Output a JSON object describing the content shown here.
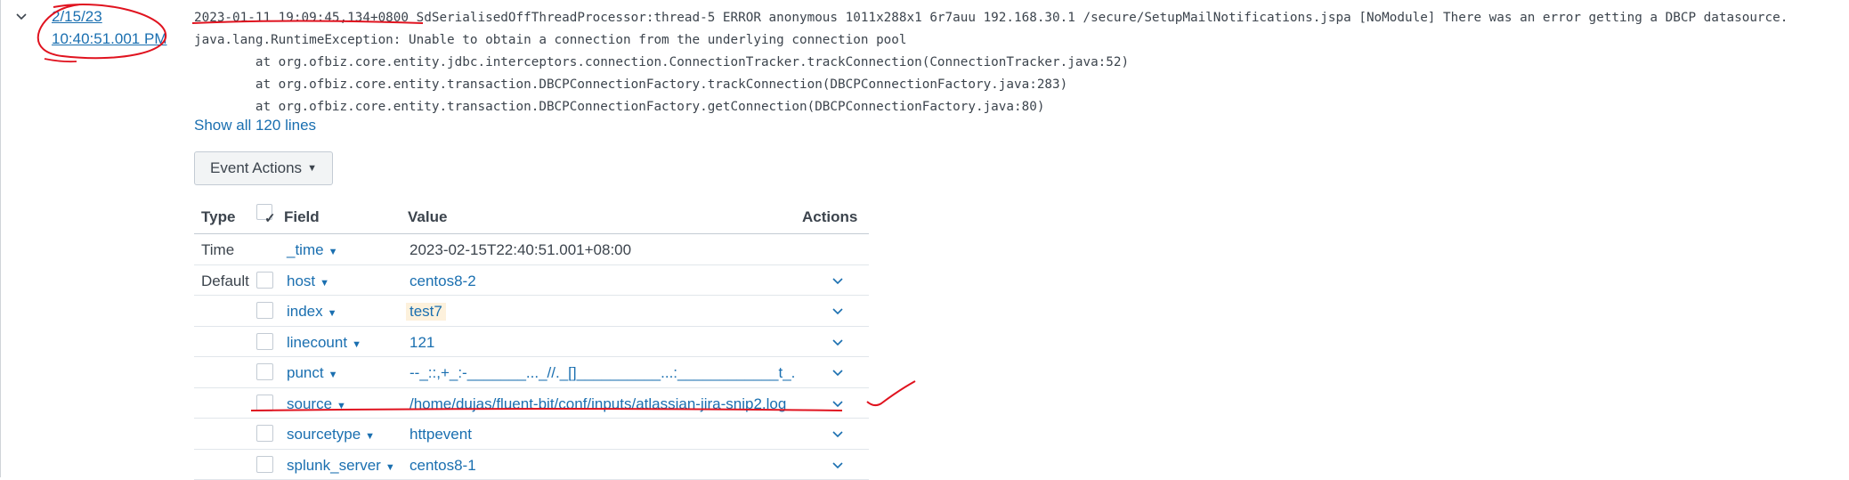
{
  "event": {
    "timestamp": {
      "date": "2/15/23",
      "time": "10:40:51.001 PM"
    },
    "raw_lines": [
      "2023-01-11 19:09:45,134+0800 SdSerialisedOffThreadProcessor:thread-5 ERROR anonymous 1011x288x1 6r7auu 192.168.30.1 /secure/SetupMailNotifications.jspa [NoModule] There was an error getting a DBCP datasource.",
      "java.lang.RuntimeException: Unable to obtain a connection from the underlying connection pool",
      "        at org.ofbiz.core.entity.jdbc.interceptors.connection.ConnectionTracker.trackConnection(ConnectionTracker.java:52)",
      "        at org.ofbiz.core.entity.transaction.DBCPConnectionFactory.trackConnection(DBCPConnectionFactory.java:283)",
      "        at org.ofbiz.core.entity.transaction.DBCPConnectionFactory.getConnection(DBCPConnectionFactory.java:80)"
    ],
    "show_all_label": "Show all 120 lines",
    "event_actions_label": "Event Actions",
    "icons": {
      "expander": "chevron-down-icon",
      "row_action": "chevron-down-icon",
      "checkbox_check": "✓"
    }
  },
  "fields_table": {
    "headers": {
      "type": "Type",
      "field": "Field",
      "value": "Value",
      "actions": "Actions"
    },
    "rows": [
      {
        "type": "Time",
        "field": "_time",
        "value": "2023-02-15T22:40:51.001+08:00"
      },
      {
        "type": "Default",
        "field": "host",
        "value": "centos8-2"
      },
      {
        "type": "",
        "field": "index",
        "value": "test7"
      },
      {
        "type": "",
        "field": "linecount",
        "value": "121"
      },
      {
        "type": "",
        "field": "punct",
        "value": "--_::,+_:-_______..._//._[]__________...:____________t_."
      },
      {
        "type": "",
        "field": "source",
        "value": "/home/dujas/fluent-bit/conf/inputs/atlassian-jira-snip2.log"
      },
      {
        "type": "",
        "field": "sourcetype",
        "value": "httpevent"
      },
      {
        "type": "",
        "field": "splunk_server",
        "value": "centos8-1"
      }
    ]
  },
  "colors": {
    "link": "#1a6fb0",
    "text": "#3c444d",
    "annotation": "#e0131f",
    "index_tag_bg": "#fdf1dc"
  }
}
